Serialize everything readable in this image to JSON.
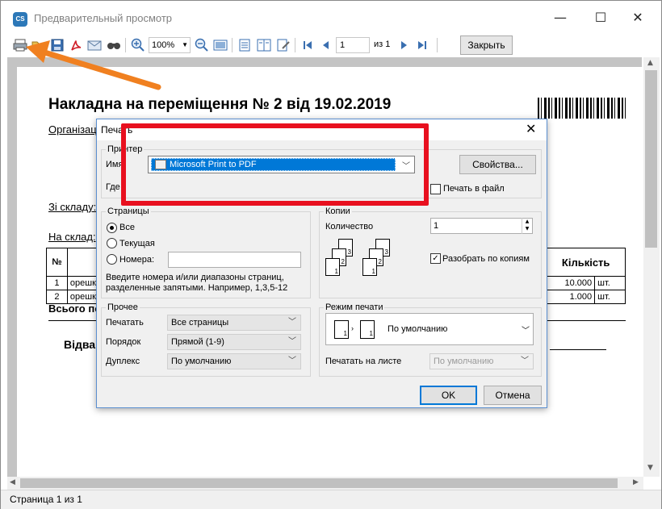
{
  "window": {
    "app_icon_text": "CS",
    "title": "Предварительный просмотр",
    "minimize": "—",
    "maximize": "☐",
    "close": "✕"
  },
  "toolbar": {
    "zoom": "100%",
    "page_current": "1",
    "page_of": "из 1",
    "close_label": "Закрыть",
    "icons": [
      "print-icon",
      "open-icon",
      "save-icon",
      "pdf-icon",
      "email-icon",
      "find-icon",
      "zoom-in-icon",
      "zoom-out-icon",
      "one-page-icon",
      "two-pages-icon",
      "multi-page-icon",
      "page-setup-icon",
      "first-page-icon",
      "prev-page-icon",
      "next-page-icon",
      "last-page-icon"
    ]
  },
  "document": {
    "title": "Накладна на переміщення № 2 від 19.02.2019",
    "org_label": "Організац",
    "from_label": "Зі складу:",
    "to_label": "На склад:",
    "table": {
      "headers": [
        "№",
        "",
        "Кількість"
      ],
      "rows": [
        {
          "num": "1",
          "name": "орешки",
          "qty": "10.000",
          "unit": "шт."
        },
        {
          "num": "2",
          "name": "орешки",
          "qty": "1.000",
          "unit": "шт."
        }
      ]
    },
    "total_label": "Всього по",
    "sign_label": "Відва"
  },
  "status": {
    "text": "Страница 1 из 1"
  },
  "print_dialog": {
    "title": "Печать",
    "printer_group": {
      "title": "Принтер",
      "name_label": "Имя",
      "name_value": "Microsoft Print to PDF",
      "where_label": "Где",
      "properties_button": "Свойства...",
      "print_to_file": "Печать в файл"
    },
    "pages_group": {
      "title": "Страницы",
      "all": "Все",
      "current": "Текущая",
      "numbers": "Номера:",
      "hint_line1": "Введите номера и/или диапазоны страниц,",
      "hint_line2": "разделенные запятыми. Например, 1,3,5-12"
    },
    "copies_group": {
      "title": "Копии",
      "count_label": "Количество",
      "count_value": "1",
      "collate": "Разобрать по копиям"
    },
    "other_group": {
      "title": "Прочее",
      "print_label": "Печатать",
      "print_value": "Все страницы",
      "order_label": "Порядок",
      "order_value": "Прямой (1-9)",
      "duplex_label": "Дуплекс",
      "duplex_value": "По умолчанию"
    },
    "mode_group": {
      "title": "Режим печати",
      "mode_value": "По умолчанию",
      "sheet_label": "Печатать на листе",
      "sheet_value": "По умолчанию"
    },
    "ok": "OK",
    "cancel": "Отмена"
  },
  "colors": {
    "highlight_box": "#e8101f",
    "arrow": "#f08020",
    "selection": "#0078d7"
  }
}
